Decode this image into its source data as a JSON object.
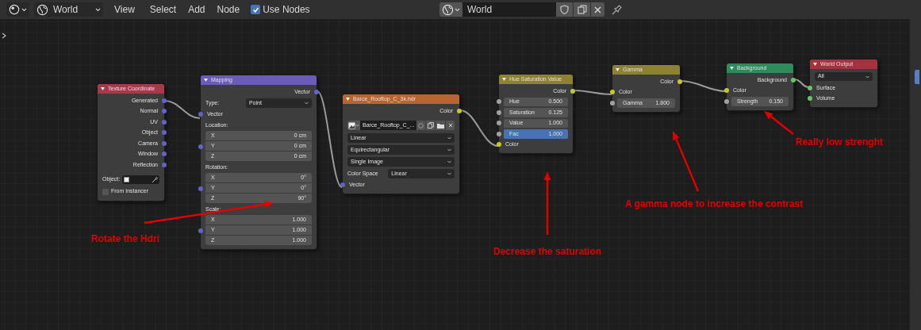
{
  "header": {
    "world_selector": "World",
    "menus": [
      "View",
      "Select",
      "Add",
      "Node"
    ],
    "use_nodes": {
      "label": "Use Nodes",
      "checked": true
    },
    "world_name": "World"
  },
  "nodes": [
    {
      "title": "Texture Coordinate",
      "color": "#a8394a",
      "rows": [
        {
          "kind": "output",
          "label": "Generated",
          "color": "#6363c7"
        },
        {
          "kind": "output",
          "label": "Normal",
          "color": "#6363c7"
        },
        {
          "kind": "output",
          "label": "UV",
          "color": "#6363c7"
        },
        {
          "kind": "output",
          "label": "Object",
          "color": "#6363c7"
        },
        {
          "kind": "output",
          "label": "Camera",
          "color": "#6363c7"
        },
        {
          "kind": "output",
          "label": "Window",
          "color": "#6363c7"
        },
        {
          "kind": "output",
          "label": "Reflection",
          "color": "#6363c7"
        },
        {
          "kind": "object_field",
          "label": "Object:"
        },
        {
          "kind": "checkbox",
          "label": "From Instancer",
          "checked": false
        }
      ]
    },
    {
      "title": "Mapping",
      "color": "#6c5cb8",
      "rows": [
        {
          "kind": "output",
          "label": "Vector",
          "color": "#6363c7"
        },
        {
          "kind": "dropdown",
          "label": "Type:",
          "value": "Point"
        },
        {
          "kind": "input",
          "label": "Vector",
          "color": "#6363c7"
        },
        {
          "kind": "vector",
          "label": "Location:",
          "color": "#6363c7",
          "components": [
            {
              "label": "X",
              "value": "0 cm"
            },
            {
              "label": "Y",
              "value": "0 cm"
            },
            {
              "label": "Z",
              "value": "0 cm"
            }
          ]
        },
        {
          "kind": "vector",
          "label": "Rotation:",
          "color": "#6363c7",
          "components": [
            {
              "label": "X",
              "value": "0°"
            },
            {
              "label": "Y",
              "value": "0°"
            },
            {
              "label": "Z",
              "value": "90°"
            }
          ]
        },
        {
          "kind": "vector",
          "label": "Scale:",
          "color": "#6363c7",
          "components": [
            {
              "label": "X",
              "value": "1.000"
            },
            {
              "label": "Y",
              "value": "1.000"
            },
            {
              "label": "Z",
              "value": "1.000"
            }
          ]
        }
      ]
    },
    {
      "title": "Barce_Rooftop_C_3k.hdr",
      "color": "#b8652f",
      "rows": [
        {
          "kind": "output",
          "label": "Color",
          "color": "#c7c729"
        },
        {
          "kind": "image_picker",
          "value": "Barce_Rooftop_C_..."
        },
        {
          "kind": "dropdown",
          "value": "Linear"
        },
        {
          "kind": "dropdown",
          "value": "Equirectangular"
        },
        {
          "kind": "dropdown",
          "value": "Single Image"
        },
        {
          "kind": "dropdown",
          "label": "Color Space",
          "value": "Linear"
        },
        {
          "kind": "input",
          "label": "Vector",
          "color": "#6363c7"
        }
      ]
    },
    {
      "title": "Hue Saturation Value",
      "color": "#8c8230",
      "rows": [
        {
          "kind": "output",
          "label": "Color",
          "color": "#c7c729"
        },
        {
          "kind": "value",
          "label": "Hue",
          "value": "0.500",
          "color": "#a1a1a1"
        },
        {
          "kind": "value",
          "label": "Saturation",
          "value": "0.125",
          "color": "#a1a1a1"
        },
        {
          "kind": "value",
          "label": "Value",
          "value": "1.000",
          "color": "#a1a1a1"
        },
        {
          "kind": "slider",
          "label": "Fac",
          "value": "1.000",
          "level": 1,
          "color": "#a1a1a1"
        },
        {
          "kind": "input",
          "label": "Color",
          "color": "#c7c729"
        }
      ]
    },
    {
      "title": "Gamma",
      "color": "#8c8230",
      "rows": [
        {
          "kind": "output",
          "label": "Color",
          "color": "#c7c729"
        },
        {
          "kind": "input",
          "label": "Color",
          "color": "#c7c729"
        },
        {
          "kind": "value",
          "label": "Gamma",
          "value": "1.800",
          "color": "#a1a1a1"
        }
      ]
    },
    {
      "title": "Background",
      "color": "#2f8a5c",
      "rows": [
        {
          "kind": "output",
          "label": "Background",
          "color": "#63c763"
        },
        {
          "kind": "input",
          "label": "Color",
          "color": "#c7c729"
        },
        {
          "kind": "value",
          "label": "Strength",
          "value": "0.150",
          "color": "#a1a1a1"
        }
      ]
    },
    {
      "title": "World Output",
      "color": "#a3343f",
      "rows": [
        {
          "kind": "dropdown",
          "value": "All"
        },
        {
          "kind": "input",
          "label": "Surface",
          "color": "#63c763"
        },
        {
          "kind": "input",
          "label": "Volume",
          "color": "#63c763"
        }
      ]
    }
  ],
  "annotations": [
    {
      "text": "Rotate the Hdri"
    },
    {
      "text": "Decrease the saturation"
    },
    {
      "text": "A gamma node to increase the contrast"
    },
    {
      "text": "Really low strenght"
    }
  ]
}
